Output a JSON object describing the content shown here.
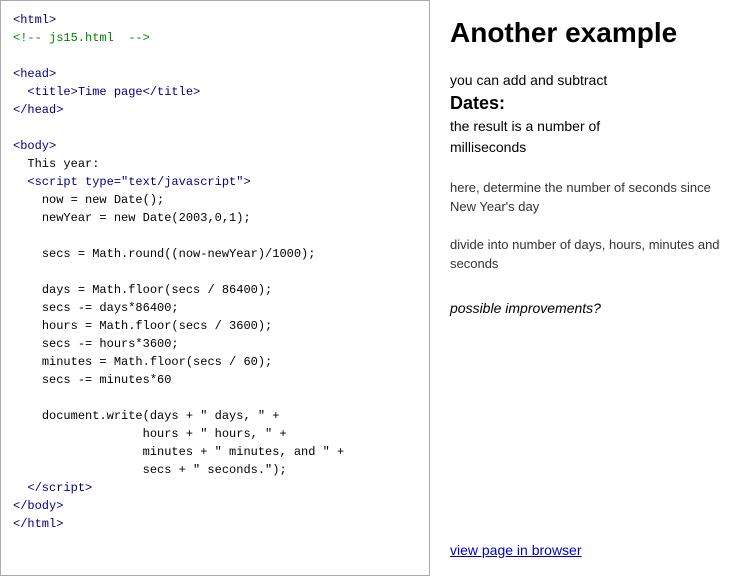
{
  "left": {
    "code_lines": [
      {
        "type": "tag",
        "text": "<html>"
      },
      {
        "type": "comment",
        "text": "<!-- js15.html  -->"
      },
      {
        "type": "blank",
        "text": ""
      },
      {
        "type": "tag",
        "text": "<head>"
      },
      {
        "type": "tag",
        "text": "  <title>Time page</title>"
      },
      {
        "type": "tag",
        "text": "</head>"
      },
      {
        "type": "blank",
        "text": ""
      },
      {
        "type": "tag",
        "text": "<body>"
      },
      {
        "type": "default",
        "text": "  This year:"
      },
      {
        "type": "tag",
        "text": "  <script type=\"text/javascript\">"
      },
      {
        "type": "default",
        "text": "    now = new Date();"
      },
      {
        "type": "default",
        "text": "    newYear = new Date(2003,0,1);"
      },
      {
        "type": "blank",
        "text": ""
      },
      {
        "type": "default",
        "text": "    secs = Math.round((now-newYear)/1000);"
      },
      {
        "type": "blank",
        "text": ""
      },
      {
        "type": "default",
        "text": "    days = Math.floor(secs / 86400);"
      },
      {
        "type": "default",
        "text": "    secs -= days*86400;"
      },
      {
        "type": "default",
        "text": "    hours = Math.floor(secs / 3600);"
      },
      {
        "type": "default",
        "text": "    secs -= hours*3600;"
      },
      {
        "type": "default",
        "text": "    minutes = Math.floor(secs / 60);"
      },
      {
        "type": "default",
        "text": "    secs -= minutes*60"
      },
      {
        "type": "blank",
        "text": ""
      },
      {
        "type": "default",
        "text": "    document.write(days + \" days, \" +"
      },
      {
        "type": "default",
        "text": "                  hours + \" hours, \" +"
      },
      {
        "type": "default",
        "text": "                  minutes + \" minutes, and \" +"
      },
      {
        "type": "default",
        "text": "                  secs + \" seconds.\");"
      },
      {
        "type": "tag",
        "text": "  </script>"
      },
      {
        "type": "tag",
        "text": "</body>"
      },
      {
        "type": "tag",
        "text": "</html>"
      }
    ]
  },
  "right": {
    "title": "Another example",
    "description_line1": "you can add and subtract",
    "description_bold": "Dates:",
    "description_line2": "the result is a number of",
    "description_line3": "milliseconds",
    "section1": "here, determine the number of seconds since New Year's day",
    "section2": "divide into number of days, hours, minutes and seconds",
    "italic_text": "possible improvements?",
    "link_text": "view page in browser"
  }
}
